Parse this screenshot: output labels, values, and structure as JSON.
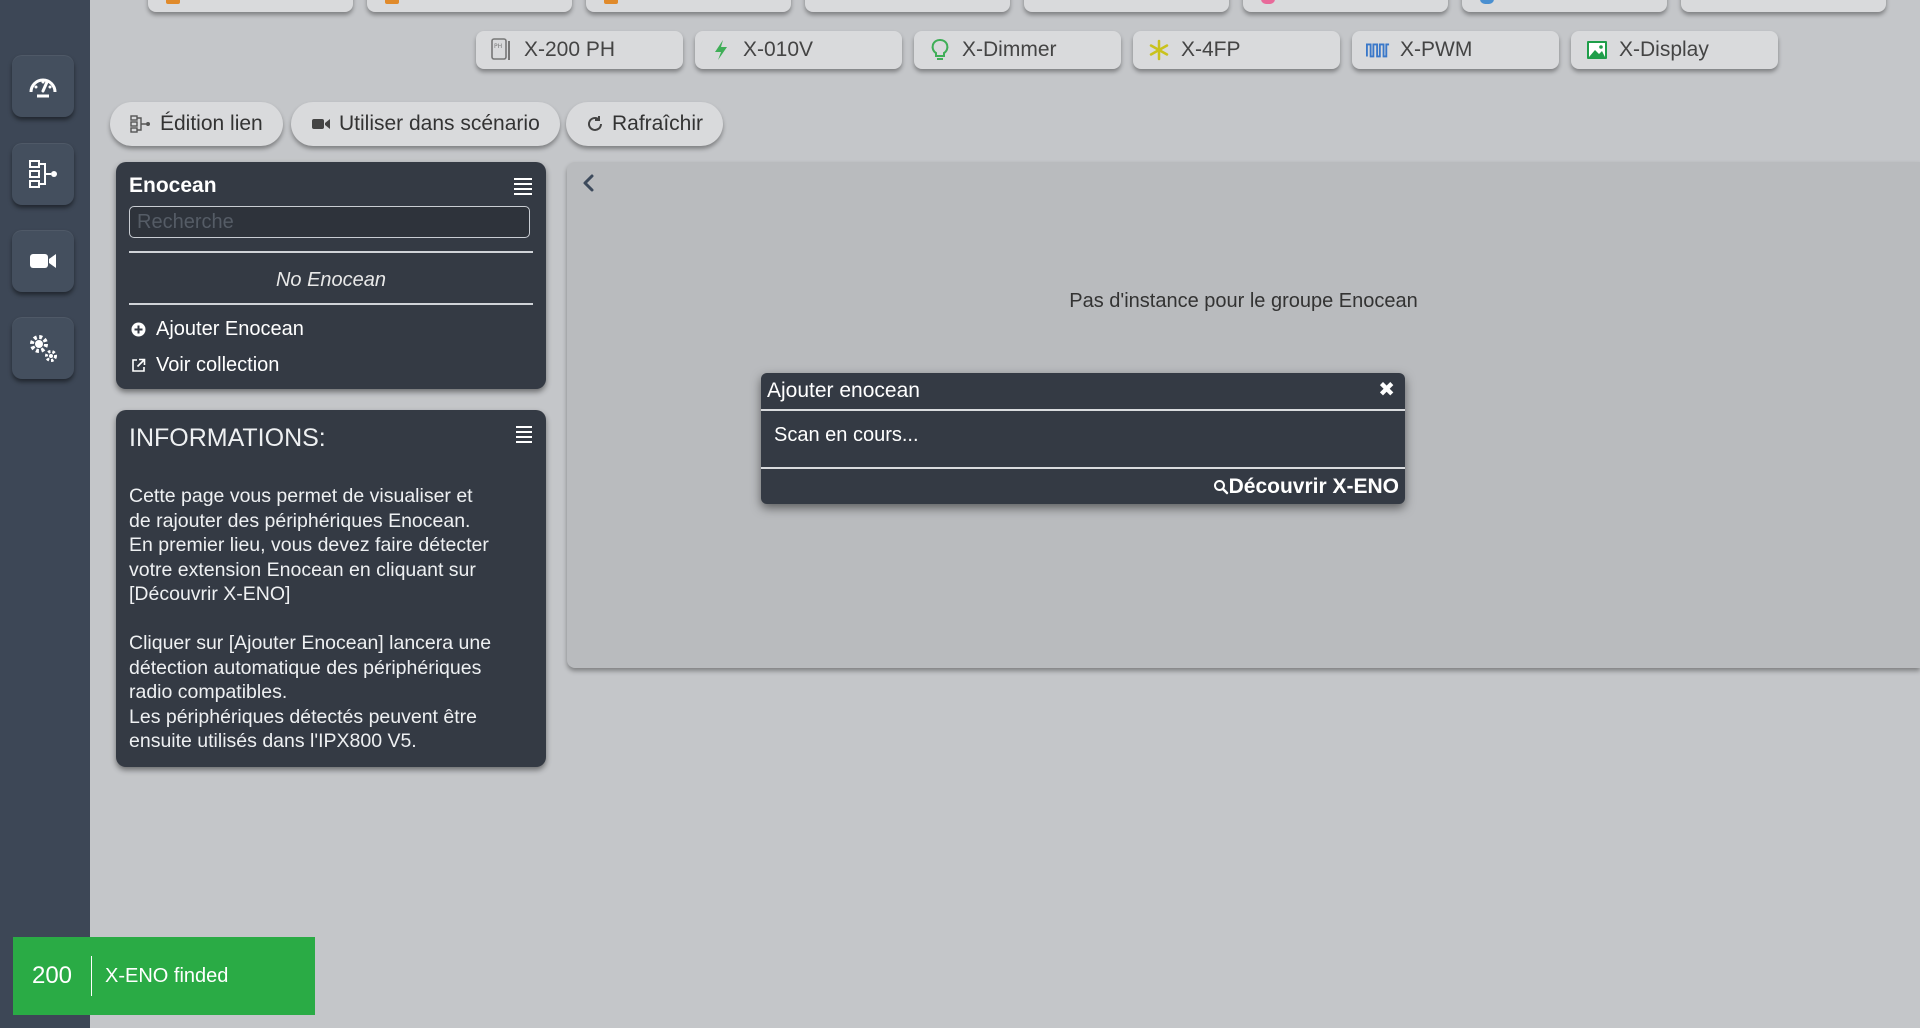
{
  "extensions": [
    {
      "label": "X-200 PH",
      "icon": "ph-probe-icon"
    },
    {
      "label": "X-010V",
      "icon": "bolt-icon"
    },
    {
      "label": "X-Dimmer",
      "icon": "bulb-icon"
    },
    {
      "label": "X-4FP",
      "icon": "snowflake-icon"
    },
    {
      "label": "X-PWM",
      "icon": "pwm-wave-icon"
    },
    {
      "label": "X-Display",
      "icon": "image-icon"
    }
  ],
  "actions": {
    "edit_link": "Édition lien",
    "use_in_scenario": "Utiliser dans scénario",
    "refresh": "Rafraîchir"
  },
  "enocean_panel": {
    "title": "Enocean",
    "search_placeholder": "Recherche",
    "empty_text": "No Enocean",
    "add_label": "Ajouter Enocean",
    "collection_label": "Voir collection"
  },
  "info_panel": {
    "title": "INFORMATIONS:",
    "paragraph1_lines": [
      "Cette page vous permet de visualiser et",
      "de rajouter des périphériques Enocean.",
      "En premier lieu, vous devez faire détecter",
      "votre extension Enocean en cliquant sur",
      "[Découvrir X-ENO]"
    ],
    "paragraph2_lines": [
      "Cliquer sur [Ajouter Enocean] lancera une",
      "détection automatique des périphériques",
      "radio compatibles.",
      "Les périphériques détectés peuvent être",
      "ensuite utilisés dans l'IPX800 V5."
    ]
  },
  "main": {
    "empty_message": "Pas d'instance pour le groupe Enocean"
  },
  "modal": {
    "title": "Ajouter enocean",
    "close": "✖",
    "body": "Scan en cours...",
    "discover_label": "Découvrir X-ENO"
  },
  "toast": {
    "code": "200",
    "message": "X-ENO finded",
    "color": "#2aab45"
  },
  "colors": {
    "sidebar": "#3d4756",
    "panel": "#343a44",
    "background": "#c4c6c9"
  }
}
